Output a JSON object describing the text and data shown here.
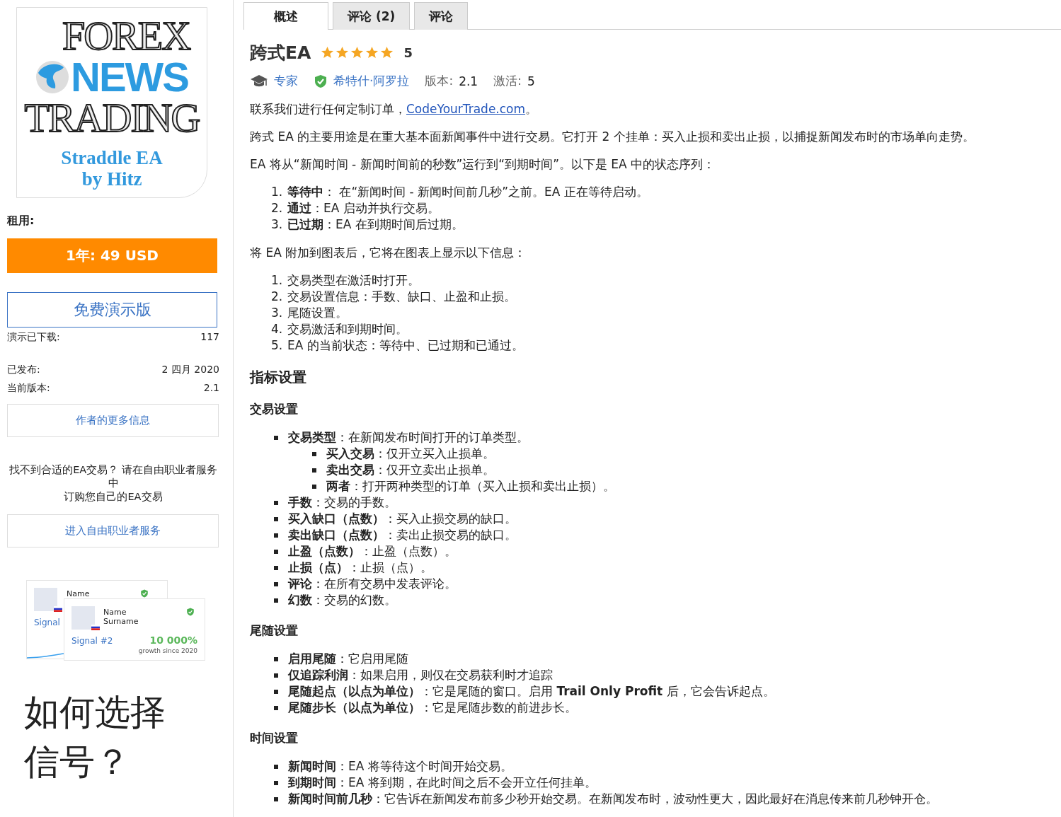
{
  "sidebar": {
    "logo": {
      "line_1": "FOREX",
      "line_2": "NEWS",
      "line_3": "TRADING",
      "line_4": "Straddle EA",
      "line_5": "by Hitz"
    },
    "rent_label": "租用:",
    "price_button": "1年: 49 USD",
    "demo_button": "免费演示版",
    "stats": [
      {
        "label": "演示已下载:",
        "value": "117"
      },
      {
        "label": "已发布:",
        "value": "2 四月 2020"
      },
      {
        "label": "当前版本:",
        "value": "2.1"
      }
    ],
    "author_button": "作者的更多信息",
    "freelance_text": [
      "找不到合适的EA交易？ 请在自由职业者服务中",
      "订购您自己的EA交易"
    ],
    "freelance_button": "进入自由职业者服务",
    "signal_ad": {
      "back_card": {
        "name": "Name",
        "signal": "Signal"
      },
      "front_card": {
        "name": "Name",
        "surname": "Surname",
        "signal": "Signal #2",
        "growth": "10 000%",
        "growth_caption": "growth since 2020"
      }
    },
    "promo_title": [
      "如何选择",
      "信号？"
    ]
  },
  "tabs": [
    {
      "label": "概述",
      "selected": true
    },
    {
      "label": "评论 (2)",
      "selected": false
    },
    {
      "label": "评论",
      "selected": false
    }
  ],
  "product": {
    "title": "跨式EA",
    "stars": 5,
    "rating": "5",
    "category": "专家",
    "author": "希特什·阿罗拉",
    "version_label": "版本:",
    "version": "2.1",
    "activations_label": "激活:",
    "activations": "5"
  },
  "content": [
    {
      "kind": "paragraph",
      "text": "联系我们进行任何定制订单，",
      "link": "CodeYourTrade.com",
      "suffix": "。"
    },
    {
      "kind": "paragraph",
      "text": "跨式 EA 的主要用途是在重大基本面新闻事件中进行交易。它打开 2 个挂单：买入止损和卖出止损，以捕捉新闻发布时的市场单向走势。"
    },
    {
      "kind": "paragraph",
      "text": "EA 将从“新闻时间 - 新闻时间前的秒数”运行到“到期时间”。以下是 EA 中的状态序列："
    },
    {
      "kind": "ordered_list",
      "items": [
        {
          "marker": "1.",
          "text": "**等待中**： 在“新闻时间 - 新闻时间前几秒”之前。EA 正在等待启动。"
        },
        {
          "marker": "2.",
          "text": "**通过**：EA 启动并执行交易。"
        },
        {
          "marker": "3.",
          "text": "**已过期**：EA 在到期时间后过期。"
        }
      ]
    },
    {
      "kind": "paragraph",
      "text": "将 EA 附加到图表后，它将在图表上显示以下信息："
    },
    {
      "kind": "ordered_list",
      "items": [
        {
          "marker": "1.",
          "text": "交易类型在激活时打开。"
        },
        {
          "marker": "2.",
          "text": "交易设置信息：手数、缺口、止盈和止损。"
        },
        {
          "marker": "3.",
          "text": "尾随设置。"
        },
        {
          "marker": "4.",
          "text": "交易激活和到期时间。"
        },
        {
          "marker": "5.",
          "text": "EA 的当前状态：等待中、已过期和已通过。"
        }
      ]
    },
    {
      "kind": "heading",
      "text": "指标设置"
    },
    {
      "kind": "subheading",
      "text": "交易设置"
    },
    {
      "kind": "bullet_list",
      "items": [
        {
          "text": "**交易类型**：在新闻发布时间打开的订单类型。",
          "children": [
            {
              "text": "**买入交易**：仅开立买入止损单。"
            },
            {
              "text": "**卖出交易**：仅开立卖出止损单。"
            },
            {
              "text": "**两者**：打开两种类型的订单（买入止损和卖出止损）。"
            }
          ]
        },
        {
          "text": "**手数**：交易的手数。"
        },
        {
          "text": "**买入缺口（点数）**：买入止损交易的缺口。"
        },
        {
          "text": "**卖出缺口（点数）**：卖出止损交易的缺口。"
        },
        {
          "text": "**止盈（点数）**：止盈（点数）。"
        },
        {
          "text": "**止损（点）**：止损（点）。"
        },
        {
          "text": "**评论**：在所有交易中发表评论。"
        },
        {
          "text": "**幻数**：交易的幻数。"
        }
      ]
    },
    {
      "kind": "subheading",
      "text": "尾随设置"
    },
    {
      "kind": "bullet_list",
      "items": [
        {
          "text": "**启用尾随**：它启用尾随"
        },
        {
          "text": "**仅追踪利润**：如果启用，则仅在交易获利时才追踪"
        },
        {
          "text": "**尾随起点（以点为单位）**：它是尾随的窗口。启用 **Trail Only Profit** 后，它会告诉起点。"
        },
        {
          "text": "**尾随步长（以点为单位）**：它是尾随步数的前进步长。"
        }
      ]
    },
    {
      "kind": "subheading",
      "text": "时间设置"
    },
    {
      "kind": "bullet_list",
      "items": [
        {
          "text": "**新闻时间**：EA 将等待这个时间开始交易。"
        },
        {
          "text": "**到期时间**：EA 将到期，在此时间之后不会开立任何挂单。"
        },
        {
          "text": "**新闻时间前几秒**：它告诉在新闻发布前多少秒开始交易。在新闻发布时，波动性更大，因此最好在消息传来前几秒钟开仓。"
        }
      ]
    }
  ]
}
